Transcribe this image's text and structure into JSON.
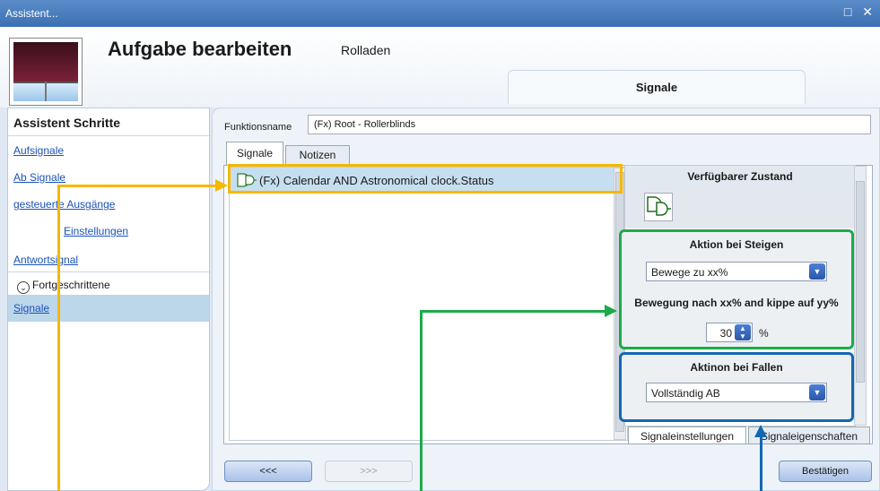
{
  "window": {
    "title": "Assistent...",
    "controls": "□ ✕"
  },
  "header": {
    "title": "Aufgabe bearbeiten",
    "subtitle": "Rolladen",
    "tab": "Signale"
  },
  "sidebar": {
    "title": "Assistent Schritte",
    "items": [
      {
        "label": "Aufsignale"
      },
      {
        "label": "Ab Signale"
      },
      {
        "label": "gesteuerte Ausgänge"
      },
      {
        "label": "Einstellungen"
      },
      {
        "label": "Antwortsignal"
      }
    ],
    "advanced": "Fortgeschrittene",
    "active_item": "Signale"
  },
  "main": {
    "function_name_label": "Funktionsname",
    "function_name_value": "(Fx) Root - Rollerblinds",
    "tabs": [
      "Signale",
      "Notizen"
    ],
    "signal_row": "(Fx) Calendar AND Astronomical clock.Status"
  },
  "right_panel": {
    "header": "Verfügbarer Zustand",
    "rise": {
      "title": "Aktion bei Steigen",
      "dropdown": "Bewege zu xx%",
      "subtitle": "Bewegung nach xx% and kippe auf yy%",
      "value": "30",
      "unit": "%"
    },
    "fall": {
      "title": "Aktinon bei Fallen",
      "dropdown": "Vollständig AB"
    },
    "bottom_tabs": [
      "Signaleinstellungen",
      "Signaleigenschaften"
    ]
  },
  "footer": {
    "back": "<<<",
    "forward": ">>>",
    "confirm": "Bestätigen"
  },
  "colors": {
    "yellow": "#f5b800",
    "green": "#1daa4a",
    "blue": "#1267b4"
  }
}
